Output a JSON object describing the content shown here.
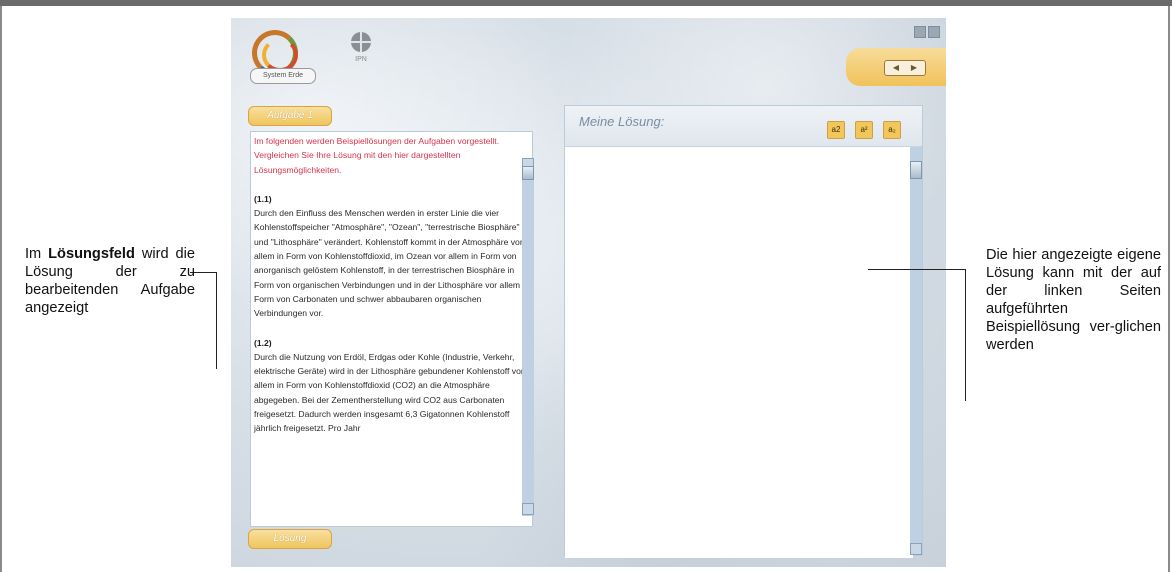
{
  "app": {
    "logo_label": "System Erde",
    "ipn_label": "IPN"
  },
  "tabs": {
    "aufgabe": "Aufgabe 1",
    "loesung": "Lösung"
  },
  "left_panel": {
    "intro": "Im folgenden werden Beispiellösungen der Aufgaben vorgestellt. Vergleichen Sie Ihre Lösung mit den hier dargestellten Lösungsmöglichkeiten.",
    "sections": [
      {
        "heading": "(1.1)",
        "text": "Durch den Einfluss des Menschen werden in erster Linie die vier Kohlenstoffspeicher \"Atmosphäre\", \"Ozean\", \"terrestrische Biosphäre\" und \"Lithosphäre\" verändert. Kohlenstoff kommt in der Atmosphäre vor allem in Form von Kohlenstoffdioxid, im Ozean vor allem in Form von anorganisch gelöstem Kohlenstoff, in der terrestrischen Biosphäre in Form von organischen Verbindungen und in der Lithosphäre vor allem in Form von Carbonaten und schwer abbaubaren organischen Verbindungen vor."
      },
      {
        "heading": "(1.2)",
        "text": "Durch die Nutzung von Erdöl, Erdgas oder Kohle (Industrie, Verkehr, elektrische Geräte) wird in der Lithosphäre gebundener Kohlenstoff vor allem in Form von Kohlenstoffdioxid (CO2) an die Atmosphäre abgegeben. Bei der Zementherstellung wird CO2 aus Carbonaten freigesetzt. Dadurch werden insgesamt 6,3 Gigatonnen Kohlenstoff jährlich freigesetzt. Pro Jahr"
      }
    ]
  },
  "right_panel": {
    "title": "Meine Lösung:",
    "format_buttons": [
      "a2",
      "a²",
      "a₂"
    ],
    "answer_value": ""
  },
  "annotations": {
    "left_pre": "Im ",
    "left_bold": "Lösungsfeld",
    "left_post": " wird die Lösung der zu bearbeitenden Aufgabe angezeigt",
    "right": "Die hier angezeigte eigene Lösung kann mit der auf der linken Seiten aufgeführten Beispiellösung ver-glichen werden"
  }
}
